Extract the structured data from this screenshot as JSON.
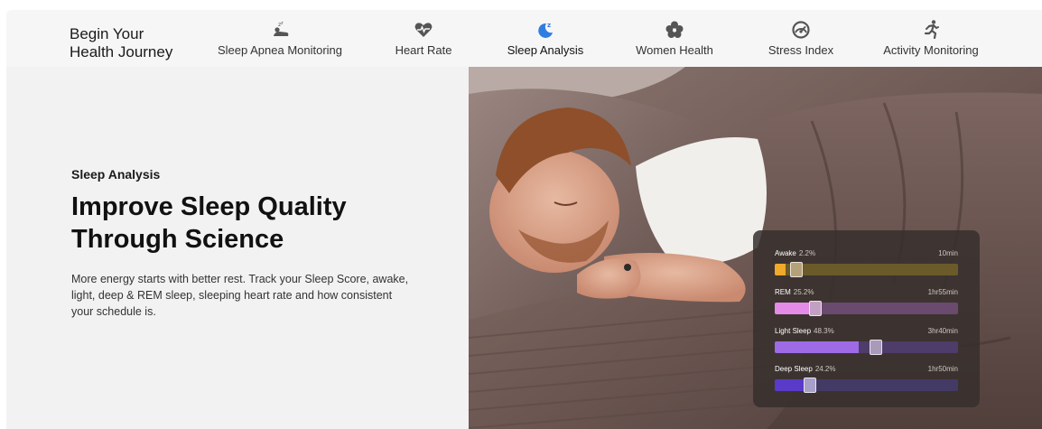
{
  "brand": {
    "line1": "Begin Your",
    "line2": "Health Journey"
  },
  "nav": {
    "tabs": [
      {
        "label": "Sleep Apnea Monitoring",
        "icon": "sleep-apnea-icon",
        "active": false
      },
      {
        "label": "Heart Rate",
        "icon": "heart-rate-icon",
        "active": false
      },
      {
        "label": "Sleep Analysis",
        "icon": "moon-sleep-icon",
        "active": true
      },
      {
        "label": "Women Health",
        "icon": "flower-icon",
        "active": false
      },
      {
        "label": "Stress Index",
        "icon": "gauge-icon",
        "active": false
      },
      {
        "label": "Activity Monitoring",
        "icon": "running-icon",
        "active": false
      }
    ]
  },
  "hero": {
    "eyebrow": "Sleep Analysis",
    "headline_line1": "Improve Sleep Quality",
    "headline_line2": "Through Science",
    "description": "More energy starts with better rest. Track your Sleep Score, awake, light, deep & REM sleep, sleeping heart rate and how consistent your schedule is."
  },
  "sleep_card": {
    "rows": [
      {
        "label": "Awake",
        "percent": "2.2%",
        "duration": "10min",
        "fill_fraction": 0.06,
        "thumb_fraction": 0.12,
        "track_color": "#6b5a2a",
        "fill_color": "#f0a92a",
        "thumb_color": "#b5a07a"
      },
      {
        "label": "REM",
        "percent": "25.2%",
        "duration": "1hr55min",
        "fill_fraction": 0.22,
        "thumb_fraction": 0.22,
        "track_color": "#6a4a6e",
        "fill_color": "#e38be6",
        "thumb_color": "#c2a0c4"
      },
      {
        "label": "Light Sleep",
        "percent": "48.3%",
        "duration": "3hr40min",
        "fill_fraction": 0.46,
        "thumb_fraction": 0.55,
        "track_color": "#4e3c6a",
        "fill_color": "#9e6ae6",
        "thumb_color": "#a89ab8"
      },
      {
        "label": "Deep Sleep",
        "percent": "24.2%",
        "duration": "1hr50min",
        "fill_fraction": 0.16,
        "thumb_fraction": 0.19,
        "track_color": "#443a66",
        "fill_color": "#5a3ac8",
        "thumb_color": "#a8a0c8"
      }
    ]
  },
  "colors": {
    "active_icon": "#2f7de1",
    "icon": "#555555"
  }
}
